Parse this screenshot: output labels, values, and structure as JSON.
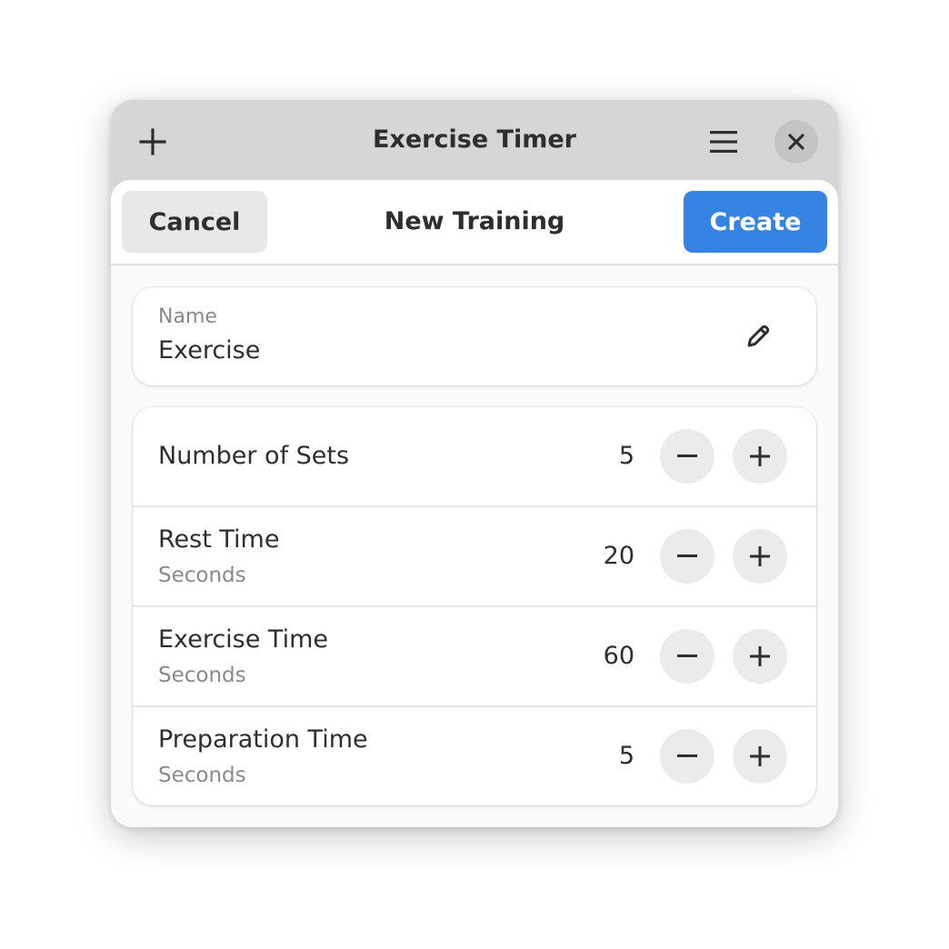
{
  "window": {
    "title": "Exercise Timer"
  },
  "icons": {
    "add": "plus-icon",
    "menu": "hamburger-menu-icon",
    "close": "close-icon",
    "edit": "pencil-icon",
    "decrement": "minus-icon",
    "increment": "plus-icon"
  },
  "dialog": {
    "title": "New Training",
    "cancel_label": "Cancel",
    "create_label": "Create"
  },
  "name_field": {
    "label": "Name",
    "value": "Exercise"
  },
  "settings": [
    {
      "title": "Number of Sets",
      "subtitle": "",
      "value": "5"
    },
    {
      "title": "Rest Time",
      "subtitle": "Seconds",
      "value": "20"
    },
    {
      "title": "Exercise Time",
      "subtitle": "Seconds",
      "value": "60"
    },
    {
      "title": "Preparation Time",
      "subtitle": "Seconds",
      "value": "5"
    }
  ],
  "colors": {
    "accent": "#3584e4",
    "titlebar": "#d6d6d6",
    "button_neutral": "#e8e8e8"
  }
}
